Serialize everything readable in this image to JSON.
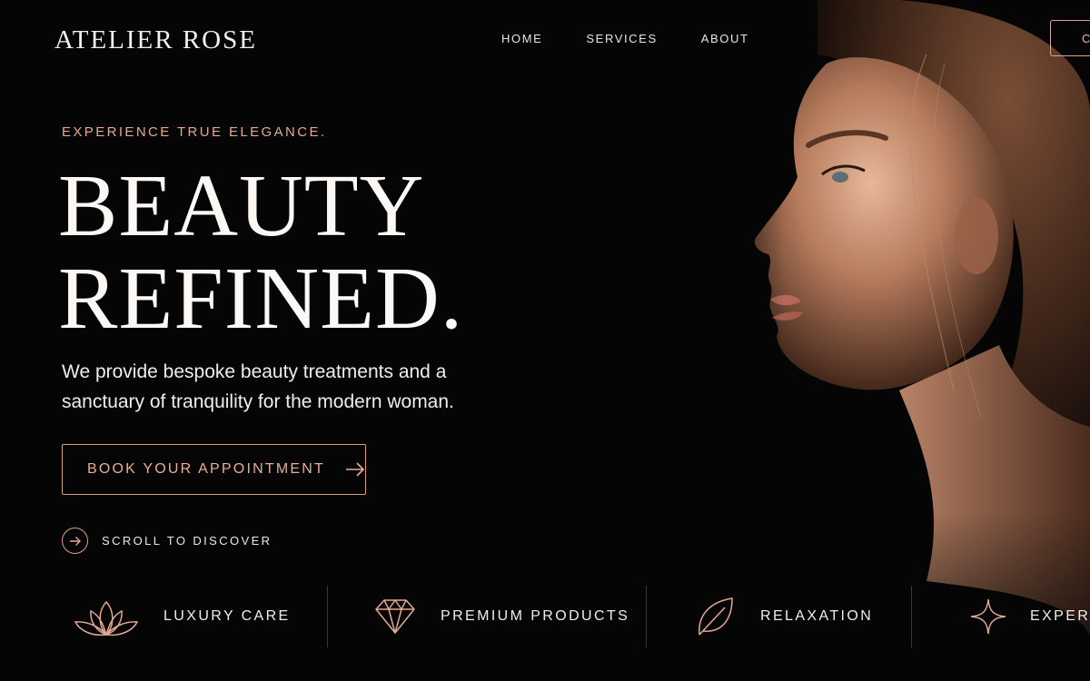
{
  "brand": "ATELIER ROSE",
  "nav": {
    "items": [
      "HOME",
      "SERVICES",
      "ABOUT"
    ]
  },
  "header": {
    "contact_label": "C"
  },
  "hero": {
    "eyebrow": "EXPERIENCE TRUE ELEGANCE.",
    "headline_line1": "BEAUTY",
    "headline_line2": "REFINED.",
    "lead": "We provide bespoke beauty treatments and a sanctuary of tranquility for the modern woman.",
    "cta_label": "BOOK YOUR APPOINTMENT",
    "scroll_label": "SCROLL TO DISCOVER"
  },
  "features": [
    {
      "label": "LUXURY CARE",
      "icon": "lotus-icon"
    },
    {
      "label": "PREMIUM PRODUCTS",
      "icon": "diamond-icon"
    },
    {
      "label": "RELAXATION",
      "icon": "leaf-icon"
    },
    {
      "label": "EXPERT",
      "icon": "sparkle-icon"
    }
  ],
  "colors": {
    "background": "#050505",
    "accent": "#e3a894",
    "text": "#f4efea"
  }
}
